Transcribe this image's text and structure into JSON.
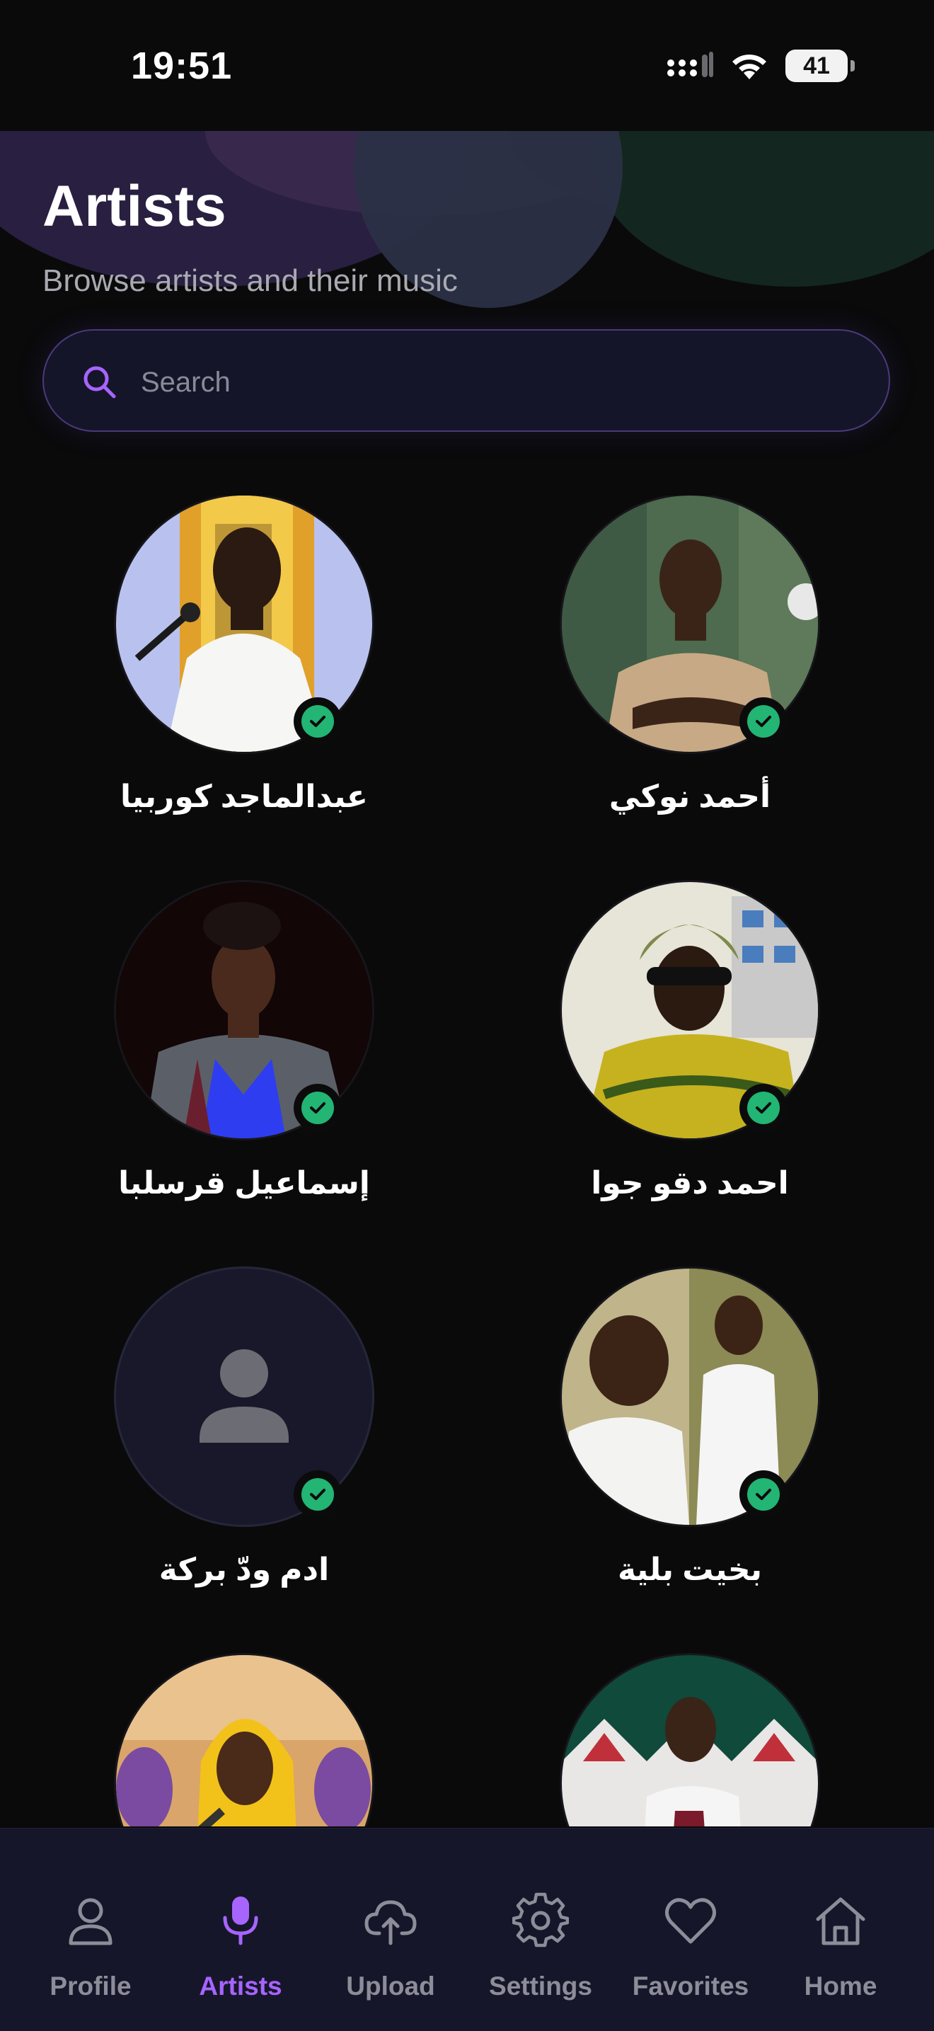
{
  "status_bar": {
    "time": "19:51",
    "battery": "41"
  },
  "header": {
    "title": "Artists",
    "subtitle": "Browse artists and their music"
  },
  "search": {
    "placeholder": "Search"
  },
  "artists": [
    {
      "name": "عبدالماجد كوربيا",
      "verified": true
    },
    {
      "name": "أحمد نوكي",
      "verified": true
    },
    {
      "name": "إسماعيل قرسلبا",
      "verified": true
    },
    {
      "name": "احمد دقو جوا",
      "verified": true
    },
    {
      "name": "ادم ودّ بركة",
      "verified": true
    },
    {
      "name": "بخيت بلية",
      "verified": true
    },
    {
      "name": "",
      "verified": false
    },
    {
      "name": "",
      "verified": false
    }
  ],
  "bottom_nav": {
    "items": [
      {
        "label": "Profile",
        "icon": "person-icon"
      },
      {
        "label": "Artists",
        "icon": "microphone-icon"
      },
      {
        "label": "Upload",
        "icon": "cloud-upload-icon"
      },
      {
        "label": "Settings",
        "icon": "gear-icon"
      },
      {
        "label": "Favorites",
        "icon": "heart-icon"
      },
      {
        "label": "Home",
        "icon": "home-icon"
      }
    ],
    "active": "Artists"
  },
  "colors": {
    "accent": "#a764ff",
    "verified": "#22b573",
    "background": "#0a0a0b",
    "nav_background": "#16162a"
  }
}
